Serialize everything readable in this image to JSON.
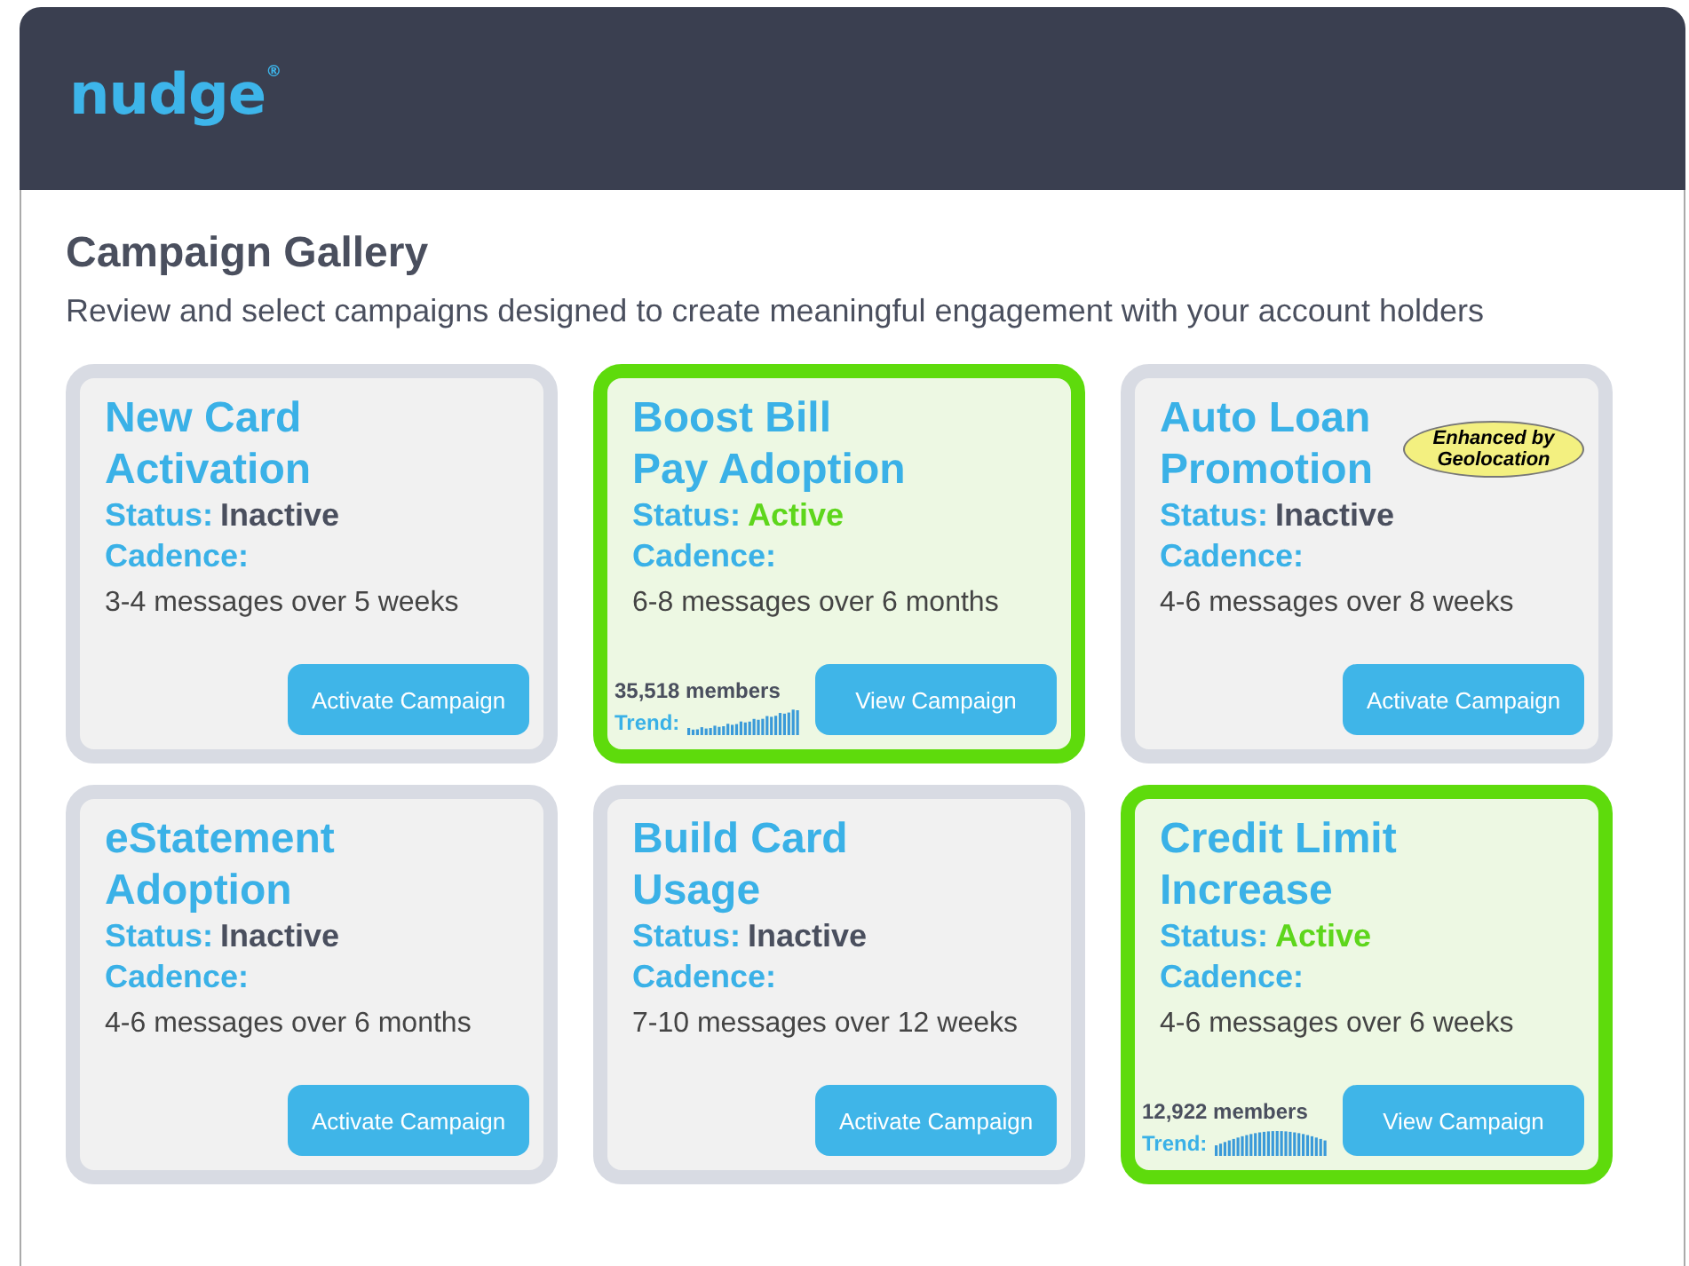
{
  "header": {
    "logo": "nudge",
    "logo_mark": "®"
  },
  "page": {
    "title": "Campaign Gallery",
    "subtitle": "Review and select campaigns designed to create meaningful engagement with your account holders"
  },
  "campaigns": [
    {
      "title_lines": [
        "New Card",
        "Activation"
      ],
      "status_label": "Status:",
      "status": "Inactive",
      "active": false,
      "cadence_label": "Cadence:",
      "cadence": "3-4 messages over 5 weeks",
      "button": "Activate Campaign"
    },
    {
      "title_lines": [
        "Boost Bill",
        "Pay Adoption"
      ],
      "status_label": "Status:",
      "status": "Active",
      "active": true,
      "cadence_label": "Cadence:",
      "cadence": "6-8 messages over 6 months",
      "button": "View Campaign",
      "members": "35,518 members",
      "trend": {
        "label": "Trend:"
      }
    },
    {
      "title_lines": [
        "Auto Loan",
        "Promotion"
      ],
      "badge": "Enhanced by Geolocation",
      "status_label": "Status:",
      "status": "Inactive",
      "active": false,
      "cadence_label": "Cadence:",
      "cadence": "4-6 messages over 8 weeks",
      "button": "Activate Campaign"
    },
    {
      "title_lines": [
        "eStatement",
        "Adoption"
      ],
      "status_label": "Status:",
      "status": "Inactive",
      "active": false,
      "cadence_label": "Cadence:",
      "cadence": "4-6 messages over 6 months",
      "button": "Activate Campaign"
    },
    {
      "title_lines": [
        "Build Card",
        "Usage"
      ],
      "status_label": "Status:",
      "status": "Inactive",
      "active": false,
      "cadence_label": "Cadence:",
      "cadence": "7-10 messages over 12 weeks",
      "button": "Activate Campaign"
    },
    {
      "title_lines": [
        "Credit Limit",
        "Increase"
      ],
      "status_label": "Status:",
      "status": "Active",
      "active": true,
      "cadence_label": "Cadence:",
      "cadence": "4-6 messages over 6 weeks",
      "button": "View Campaign",
      "members": "12,922 members",
      "trend": {
        "label": "Trend:"
      }
    }
  ]
}
